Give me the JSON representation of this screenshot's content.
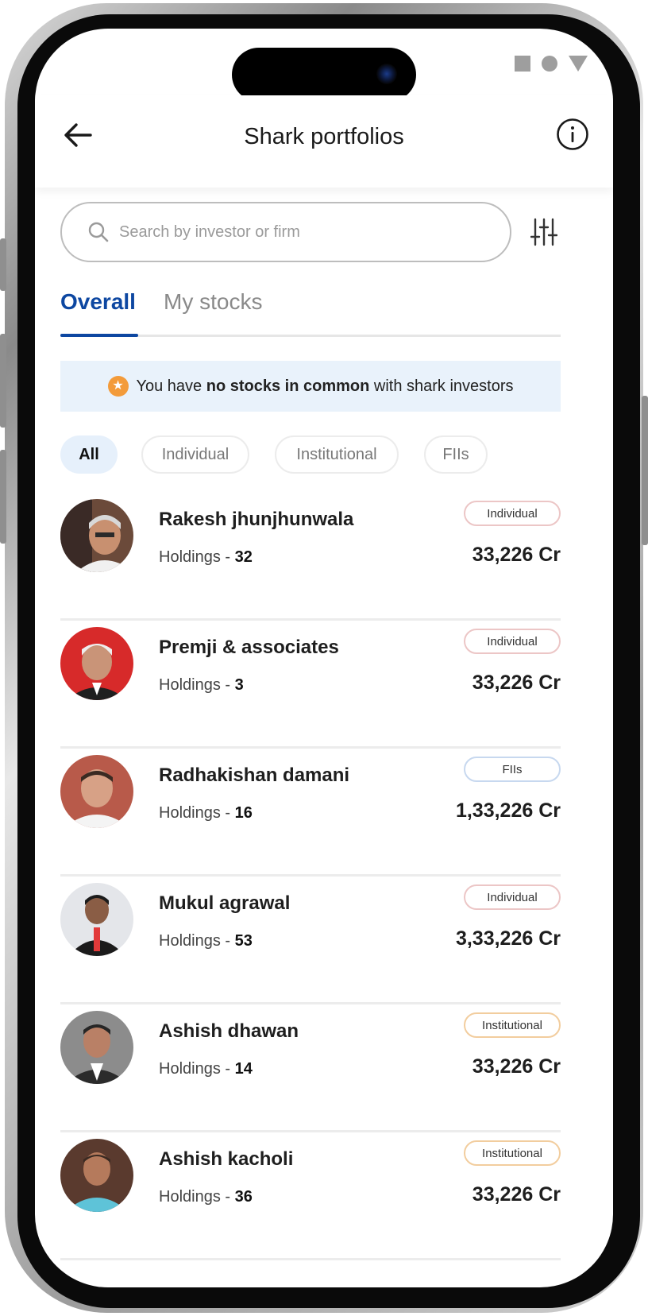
{
  "header": {
    "title": "Shark portfolios"
  },
  "search": {
    "placeholder": "Search by investor or firm",
    "value": ""
  },
  "tabs": [
    {
      "label": "Overall",
      "active": true
    },
    {
      "label": "My stocks",
      "active": false
    }
  ],
  "banner": {
    "prefix": "You have ",
    "bold": "no stocks in common",
    "suffix": " with shark investors",
    "icon": "star-icon"
  },
  "chips": [
    {
      "label": "All",
      "selected": true
    },
    {
      "label": "Individual",
      "selected": false
    },
    {
      "label": "Institutional",
      "selected": false
    },
    {
      "label": "FIIs",
      "selected": false
    }
  ],
  "holdings_label": "Holdings - ",
  "investors": [
    {
      "name": "Rakesh jhunjhunwala",
      "holdings": "32",
      "type": "Individual",
      "amount": "33,226 Cr"
    },
    {
      "name": "Premji & associates",
      "holdings": "3",
      "type": "Individual",
      "amount": "33,226 Cr"
    },
    {
      "name": "Radhakishan damani",
      "holdings": "16",
      "type": "FIIs",
      "amount": "1,33,226 Cr"
    },
    {
      "name": "Mukul agrawal",
      "holdings": "53",
      "type": "Individual",
      "amount": "3,33,226 Cr"
    },
    {
      "name": "Ashish dhawan",
      "holdings": "14",
      "type": "Institutional",
      "amount": "33,226 Cr"
    },
    {
      "name": "Ashish kacholi",
      "holdings": "36",
      "type": "Institutional",
      "amount": "33,226 Cr"
    }
  ],
  "colors": {
    "accent": "#0d47a1",
    "banner_bg": "#e9f2fb",
    "star": "#f39b3a"
  }
}
